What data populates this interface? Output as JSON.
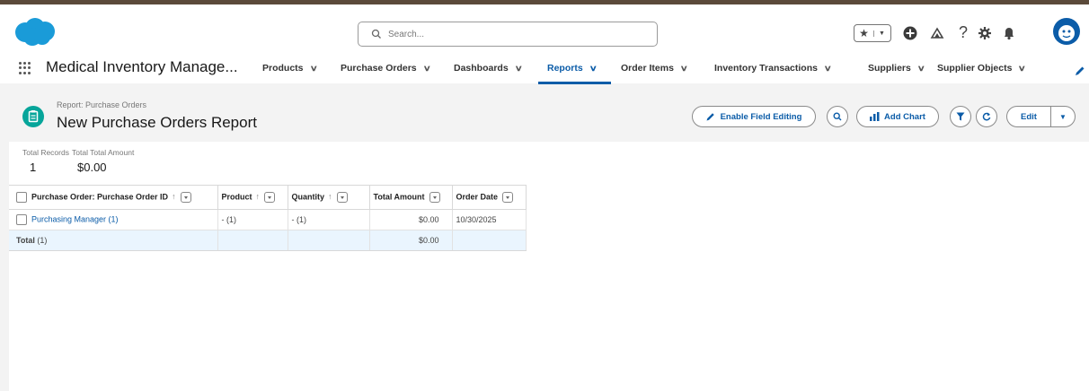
{
  "header": {
    "search_placeholder": "Search...",
    "colors": {
      "brand": "#0b5ca8",
      "salesforce_cloud": "#1a9bd8",
      "report_icon": "#06a59a"
    }
  },
  "nav": {
    "app_name": "Medical Inventory Manage...",
    "tabs": [
      {
        "label": "Products"
      },
      {
        "label": "Purchase Orders"
      },
      {
        "label": "Dashboards"
      },
      {
        "label": "Reports",
        "active": true
      },
      {
        "label": "Order Items"
      },
      {
        "label": "Inventory Transactions"
      },
      {
        "label": "Suppliers"
      },
      {
        "label": "Supplier Objects"
      }
    ]
  },
  "report": {
    "subtitle": "Report: Purchase Orders",
    "title": "New Purchase Orders Report",
    "buttons": {
      "enable_field_editing": "Enable Field Editing",
      "add_chart": "Add Chart",
      "edit": "Edit"
    },
    "summary": {
      "total_records_label": "Total Records",
      "total_records_value": "1",
      "total_amount_label": "Total Total Amount",
      "total_amount_value": "$0.00"
    },
    "table": {
      "columns": [
        "Purchase Order: Purchase Order ID",
        "Product",
        "Quantity",
        "Total Amount",
        "Order Date"
      ],
      "group_row": {
        "name": "Purchasing Manager (1)",
        "product": "- (1)",
        "quantity": "- (1)",
        "total_amount": "$0.00",
        "order_date": "10/30/2025"
      },
      "total_row": {
        "label": "Total",
        "count": "(1)",
        "total_amount": "$0.00"
      }
    }
  }
}
